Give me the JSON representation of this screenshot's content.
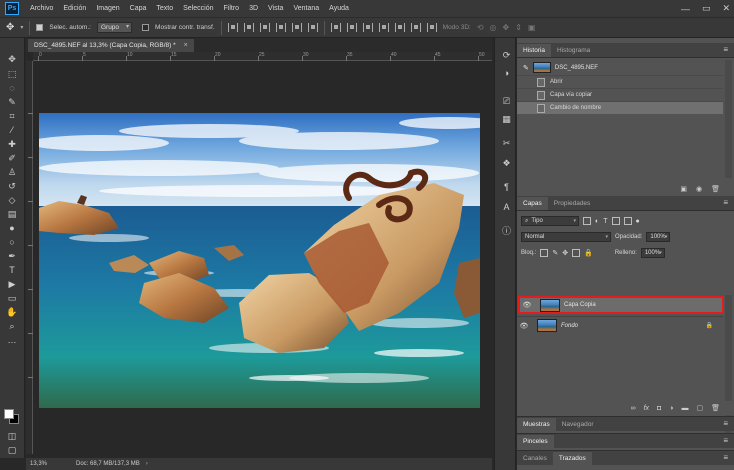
{
  "app": {
    "logo_text": "Ps"
  },
  "menu": [
    "Archivo",
    "Edición",
    "Imagen",
    "Capa",
    "Texto",
    "Selección",
    "Filtro",
    "3D",
    "Vista",
    "Ventana",
    "Ayuda"
  ],
  "window_controls": {
    "minimize": "—",
    "maximize": "▭",
    "close": "✕"
  },
  "options": {
    "autoselect_label": "Selec. autom.:",
    "autoselect_value": "Grupo",
    "transform_label": "Mostrar contr. transf.",
    "mode_3d": "Modo 3D:"
  },
  "document": {
    "tab_title": "DSC_4895.NEF al 13,3% (Capa Copia, RGB/8) *",
    "close": "×"
  },
  "ruler_h_ticks": [
    "0",
    "5",
    "10",
    "15",
    "20",
    "25",
    "30",
    "35",
    "40",
    "45",
    "50"
  ],
  "status": {
    "zoom": "13,3%",
    "doc_size": "Doc: 68,7 MB/137,3 MB",
    "arrow": "›"
  },
  "history_panel": {
    "tabs": [
      "Historia",
      "Histograma"
    ],
    "snapshot": "DSC_4895.NEF",
    "steps": [
      "Abrir",
      "Capa vía copiar",
      "Cambio de nombre"
    ]
  },
  "layers_panel": {
    "tabs": [
      "Capas",
      "Propiedades"
    ],
    "filter_label": "Tipo",
    "blend_mode": "Normal",
    "opacity_label": "Opacidad:",
    "opacity_value": "100%",
    "lock_label": "Bloq.:",
    "fill_label": "Relleno:",
    "fill_value": "100%",
    "layers": [
      {
        "name": "Capa Copia"
      },
      {
        "name": "Fondo"
      }
    ],
    "footer_icons": [
      "link-icon",
      "fx-icon",
      "mask-icon",
      "adjustment-icon",
      "group-icon",
      "new-layer-icon",
      "trash-icon"
    ],
    "fx_label": "fx"
  },
  "bottom_panels": {
    "group1": [
      "Muestras",
      "Navegador"
    ],
    "group2": [
      "Pinceles"
    ],
    "group3": [
      "Canales",
      "Trazados"
    ]
  },
  "colors": {
    "selected_layer_highlight": "#e31d1d",
    "accent_blue": "#31a8ff"
  }
}
